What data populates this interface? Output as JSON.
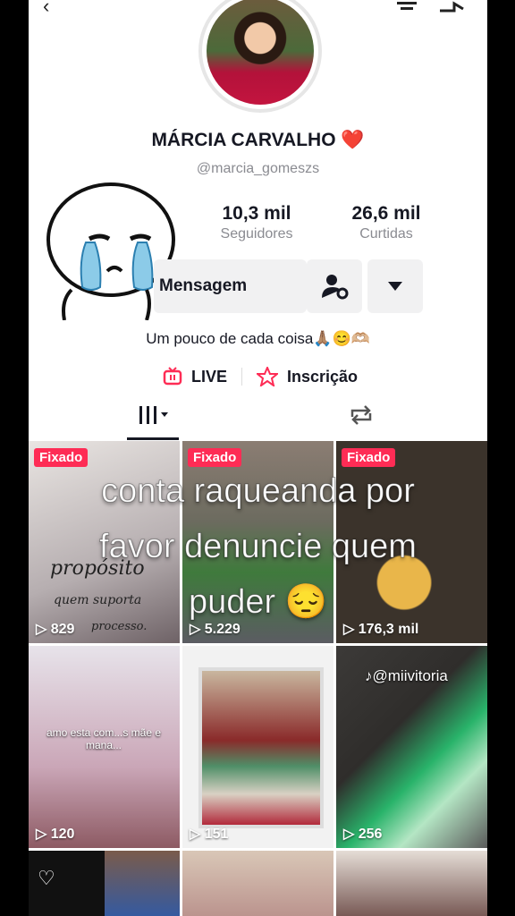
{
  "profile": {
    "name": "MÁRCIA CARVALHO",
    "name_emoji": "❤️",
    "handle": "@marcia_gomeszs",
    "stats": [
      {
        "value": "10,3 mil",
        "label": "Seguidores"
      },
      {
        "value": "26,6 mil",
        "label": "Curtidas"
      }
    ],
    "message_button": "Mensagem",
    "bio": "Um pouco de cada coisa🙏🏽😊🫶🏼",
    "live_label": "LIVE",
    "subscription_label": "Inscrição"
  },
  "overlay_text": [
    "conta raqueanda por",
    "favor denuncie quem",
    "puder 😔"
  ],
  "videos": [
    {
      "pinned": "Fixado",
      "views": "829",
      "caption_lines": [
        "propósito",
        "quem suporta",
        "processo."
      ]
    },
    {
      "pinned": "Fixado",
      "views": "5.229"
    },
    {
      "pinned": "Fixado",
      "views": "176,3 mil"
    },
    {
      "views": "120",
      "caption": "amo esta com...s mãe e mana..."
    },
    {
      "views": "151"
    },
    {
      "views": "256",
      "watermark": "@miivitoria"
    }
  ],
  "colors": {
    "accent": "#fe2c55",
    "text": "#161823",
    "muted": "#8a8b91"
  }
}
